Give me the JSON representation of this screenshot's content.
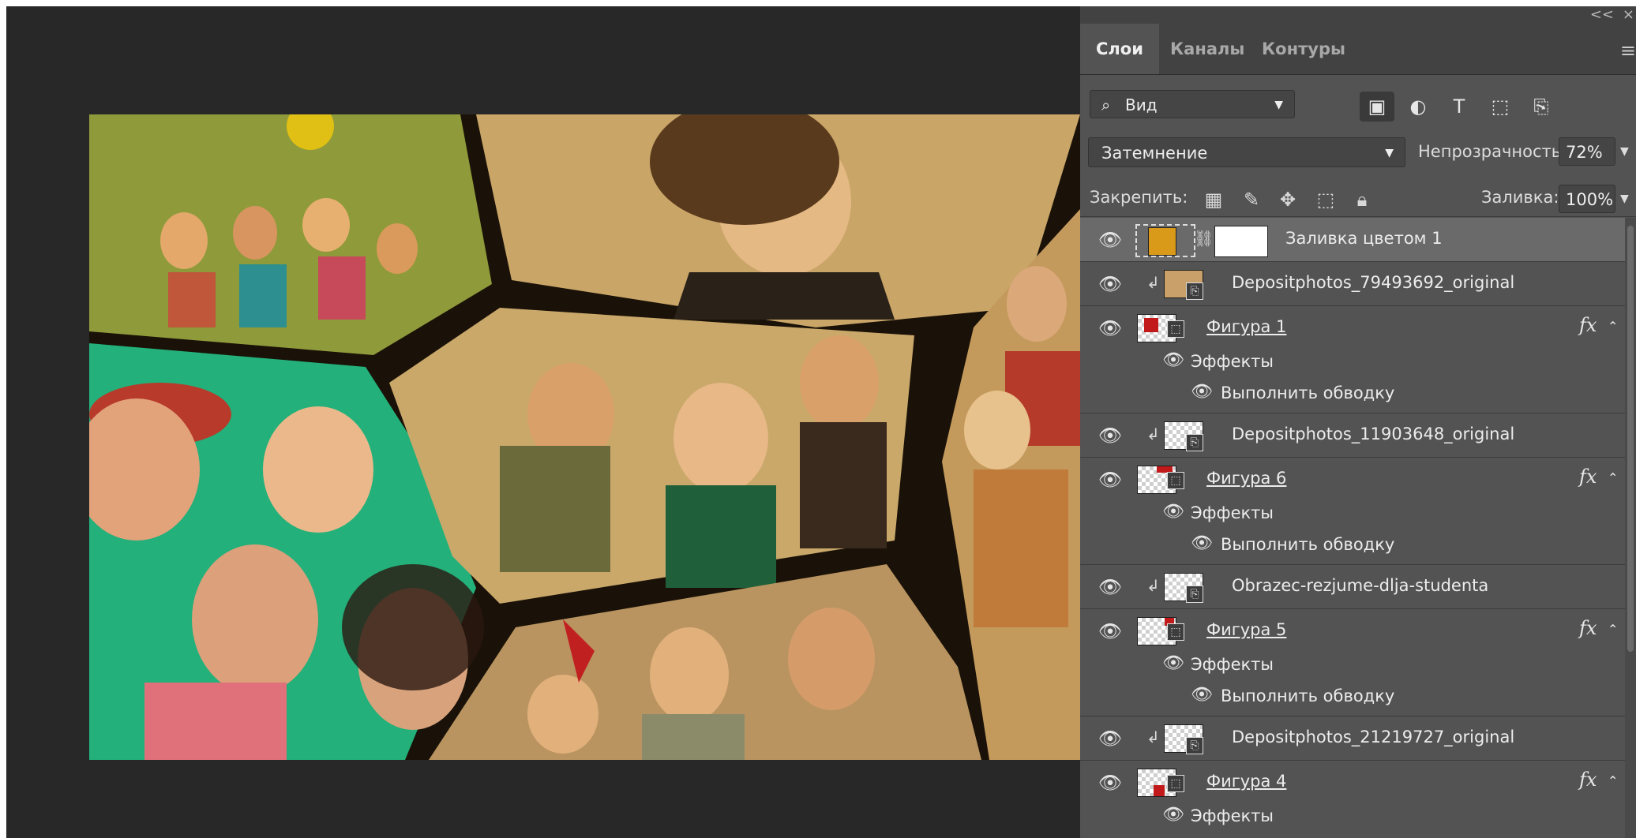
{
  "window": {
    "collapse_label": "<<",
    "close_label": "×"
  },
  "tabs": [
    {
      "label": "Слои",
      "active": true
    },
    {
      "label": "Каналы",
      "active": false
    },
    {
      "label": "Контуры",
      "active": false
    }
  ],
  "panel_menu_icon": "hamburger-menu-icon",
  "filter": {
    "kind_label": "Вид",
    "icons": [
      "image-filter-icon",
      "adjustment-filter-icon",
      "type-filter-icon",
      "shape-filter-icon",
      "smart-object-filter-icon"
    ]
  },
  "blend": {
    "mode": "Затемнение",
    "opacity_label": "Непрозрачность:",
    "opacity_value": "72%"
  },
  "lock": {
    "label": "Закрепить:",
    "icons": [
      "lock-transparent-pixels-icon",
      "lock-image-pixels-icon",
      "lock-position-icon",
      "lock-artboard-icon",
      "lock-all-icon"
    ],
    "fill_label": "Заливка:",
    "fill_value": "100%"
  },
  "layers": [
    {
      "name": "Заливка цветом 1",
      "type": "fill",
      "selected": true,
      "fill_color": "#d99a1a"
    },
    {
      "name": "Depositphotos_79493692_original",
      "type": "smart",
      "clipped": true
    },
    {
      "name": "Фигура 1",
      "type": "shape",
      "fx": true,
      "effects_label": "Эффекты",
      "effect": "Выполнить обводку"
    },
    {
      "name": "Depositphotos_11903648_original",
      "type": "smart",
      "clipped": true
    },
    {
      "name": "Фигура 6",
      "type": "shape",
      "fx": true,
      "effects_label": "Эффекты",
      "effect": "Выполнить обводку"
    },
    {
      "name": "Obrazec-rezjume-dlja-studenta",
      "type": "smart",
      "clipped": true
    },
    {
      "name": "Фигура 5",
      "type": "shape",
      "fx": true,
      "effects_label": "Эффекты",
      "effect": "Выполнить обводку"
    },
    {
      "name": "Depositphotos_21219727_original",
      "type": "smart",
      "clipped": true
    },
    {
      "name": "Фигура 4",
      "type": "shape",
      "fx": true,
      "effects_label": "Эффекты"
    }
  ],
  "fx_label": "fx",
  "colors": {
    "panel_bg": "#535353",
    "workspace_bg": "#282828",
    "selected_row": "#6a6a6a",
    "collage_tint": "#d9a24a",
    "collage_green": "#23b07a"
  }
}
